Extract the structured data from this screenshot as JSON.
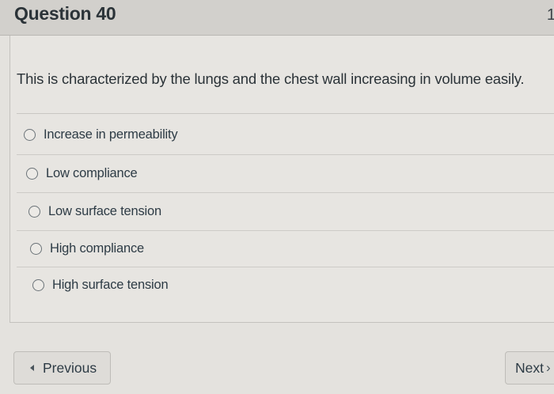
{
  "question": {
    "title": "Question 40",
    "points": "1",
    "text": "This is characterized by the lungs and the chest wall increasing in volume easily."
  },
  "answers": [
    {
      "label": "Increase in permeability",
      "selected": false
    },
    {
      "label": "Low compliance",
      "selected": false
    },
    {
      "label": "Low surface tension",
      "selected": false
    },
    {
      "label": "High compliance",
      "selected": false
    },
    {
      "label": "High surface tension",
      "selected": false
    }
  ],
  "nav": {
    "previous_label": "Previous",
    "next_label": "Next",
    "previous_icon": "chevron-left-icon",
    "next_icon": "chevron-right-icon"
  }
}
